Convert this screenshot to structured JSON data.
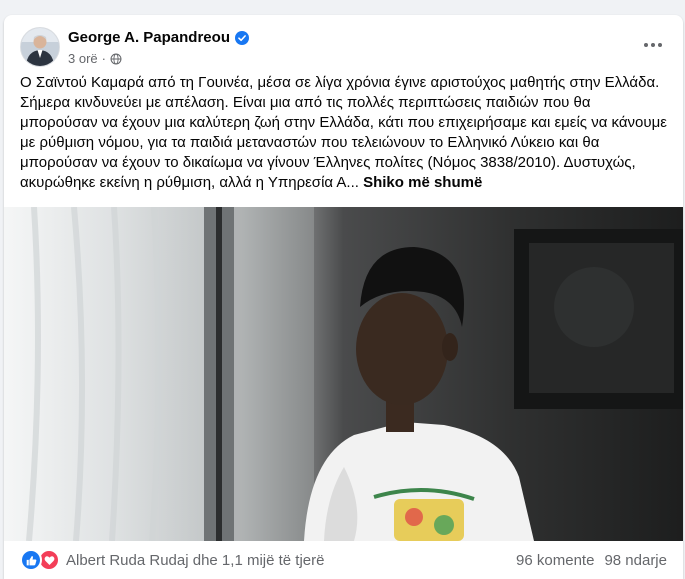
{
  "post": {
    "author": "George A. Papandreou",
    "time": "3 orë",
    "text": "Ο Σαϊντού Καμαρά από τη Γουινέα, μέσα σε λίγα χρόνια έγινε αριστούχος μαθητής στην Ελλάδα. Σήμερα κινδυνεύει με απέλαση. Είναι μια από τις πολλές περιπτώσεις παιδιών που θα μπορούσαν να έχουν μια καλύτερη ζωή στην Ελλάδα, κάτι που επιχειρήσαμε και εμείς να κάνουμε με ρύθμιση νόμου, για τα παιδιά μεταναστών που τελειώνουν το Ελληνικό Λύκειο και θα μπορούσαν να έχουν το δικαίωμα να γίνουν Έλληνες πολίτες (Νόμος 3838/2010). Δυστυχώς, ακυρώθηκε εκείνη η ρύθμιση, αλλά η Υπηρεσία Α...",
    "see_more": "Shiko më shumë"
  },
  "footer": {
    "reactors": "Albert Ruda Rudaj dhe 1,1 mijë të tjerë",
    "comments": "96 komente",
    "shares": "98 ndarje"
  },
  "colors": {
    "brand": "#1877f2",
    "love": "#f33e58",
    "secondary_text": "#65676b"
  },
  "icons": {
    "verified": "verified-badge-icon",
    "privacy": "globe-icon",
    "more": "more-options-icon",
    "like": "like-reaction-icon",
    "love": "love-reaction-icon"
  }
}
